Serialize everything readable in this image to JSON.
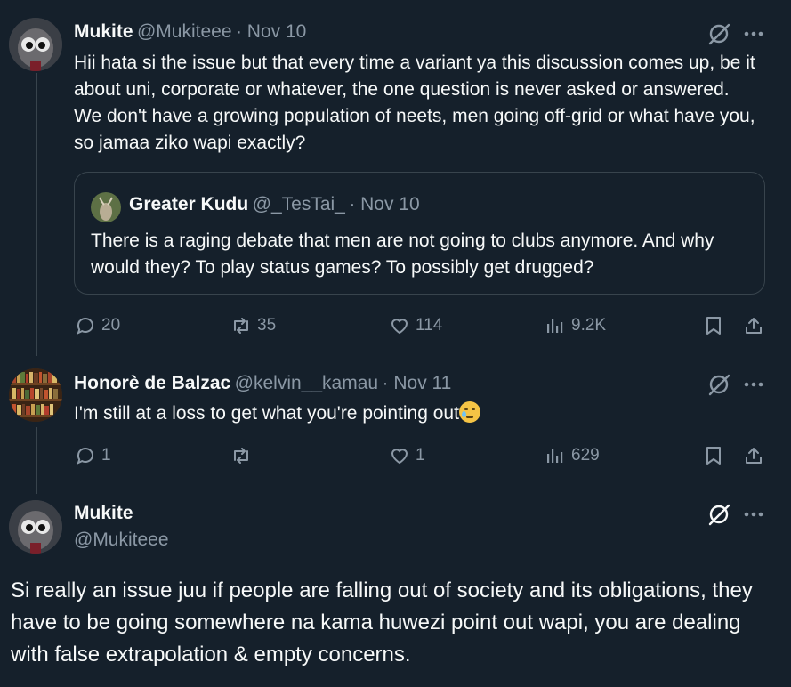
{
  "tweet1": {
    "display_name": "Mukite",
    "handle": "@Mukiteee",
    "date": "· Nov 10",
    "text": "Hii hata si the issue but that every time a variant ya this discussion comes up, be it about uni, corporate or whatever, the one question is never asked or answered. We don't have a growing population of neets, men going off-grid or what have you, so jamaa ziko wapi exactly?",
    "quote": {
      "display_name": "Greater Kudu",
      "handle": "@_TesTai_",
      "date": "· Nov 10",
      "text": "There is a raging debate that men are not going to clubs anymore. And why would they? To play status games? To possibly get drugged?"
    },
    "stats": {
      "replies": "20",
      "reposts": "35",
      "likes": "114",
      "views": "9.2K"
    }
  },
  "tweet2": {
    "display_name": "Honorè de Balzac",
    "handle": "@kelvin__kamau",
    "date": "· Nov 11",
    "text": "I'm still at a loss to get what you're pointing out",
    "emoji": "crying-face",
    "stats": {
      "replies": "1",
      "reposts": "",
      "likes": "1",
      "views": "629"
    }
  },
  "tweet3": {
    "display_name": "Mukite",
    "handle": "@Mukiteee",
    "text": "Si really an issue juu if people are falling out of society and its obligations, they have to be going somewhere na kama huwezi point out wapi, you are dealing with false extrapolation & empty concerns."
  },
  "icons": {
    "reply": "reply-icon",
    "repost": "repost-icon",
    "like": "heart-icon",
    "views": "views-icon",
    "bookmark": "bookmark-icon",
    "share": "share-icon",
    "grok": "grok-icon",
    "more": "more-icon"
  },
  "colors": {
    "background": "#15202b",
    "text": "#f7f9f9",
    "muted": "#8b98a5",
    "border": "#38444d"
  }
}
